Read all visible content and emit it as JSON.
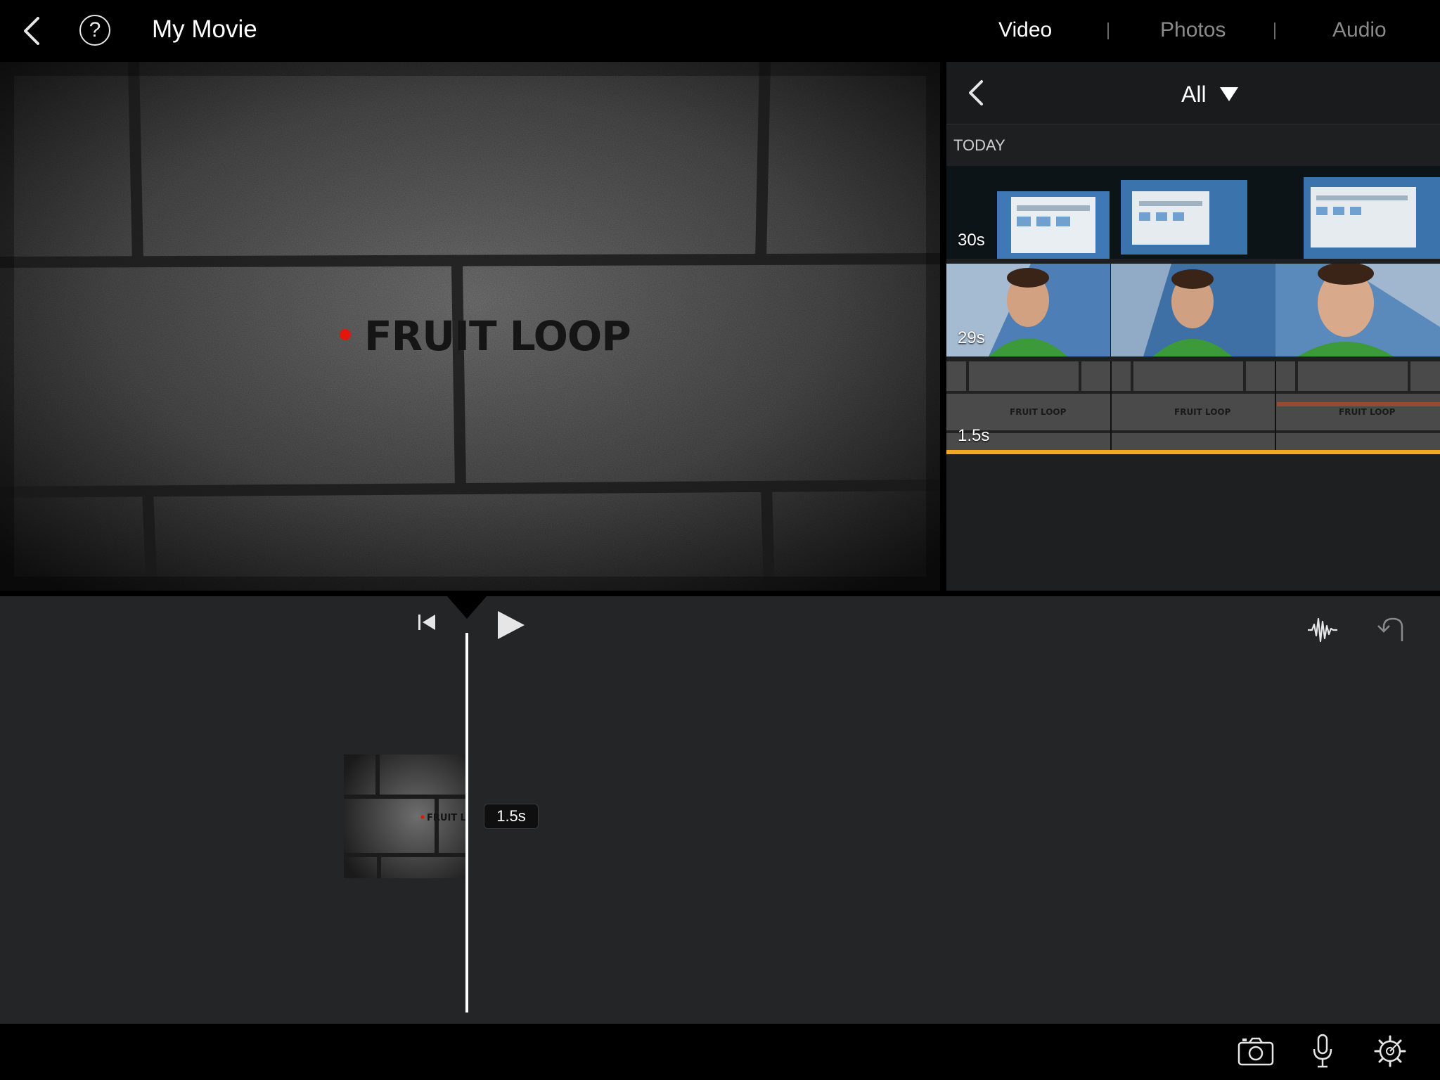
{
  "header": {
    "back_icon": "chevron-left-icon",
    "help_label": "?",
    "title": "My Movie",
    "tabs": [
      {
        "label": "Video",
        "active": true
      },
      {
        "label": "Photos",
        "active": false
      },
      {
        "label": "Audio",
        "active": false
      }
    ]
  },
  "viewer": {
    "title_text": "FRUIT LOOP"
  },
  "browser": {
    "filter_label": "All",
    "section_label": "TODAY",
    "clips": [
      {
        "duration": "30s",
        "kind": "screen recording"
      },
      {
        "duration": "29s",
        "kind": "person video"
      },
      {
        "duration": "1.5s",
        "kind": "title clip",
        "selected": true
      }
    ],
    "clip_thumb_text": "FRUIT LOOP"
  },
  "timeline": {
    "clip_duration": "1.5s",
    "clip_thumb_text": "FRUIT L"
  },
  "colors": {
    "accent": "#f5a623",
    "background": "#000000",
    "timeline_bg": "#242527",
    "browser_bg": "#1e1f21"
  }
}
